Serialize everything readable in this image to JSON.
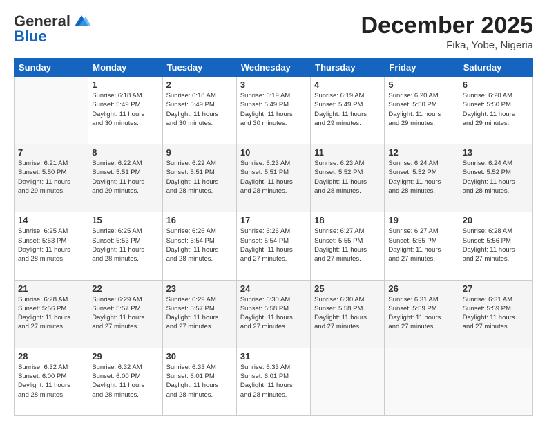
{
  "header": {
    "logo_general": "General",
    "logo_blue": "Blue",
    "main_title": "December 2025",
    "subtitle": "Fika, Yobe, Nigeria"
  },
  "columns": [
    "Sunday",
    "Monday",
    "Tuesday",
    "Wednesday",
    "Thursday",
    "Friday",
    "Saturday"
  ],
  "weeks": [
    [
      {
        "num": "",
        "info": ""
      },
      {
        "num": "1",
        "info": "Sunrise: 6:18 AM\nSunset: 5:49 PM\nDaylight: 11 hours\nand 30 minutes."
      },
      {
        "num": "2",
        "info": "Sunrise: 6:18 AM\nSunset: 5:49 PM\nDaylight: 11 hours\nand 30 minutes."
      },
      {
        "num": "3",
        "info": "Sunrise: 6:19 AM\nSunset: 5:49 PM\nDaylight: 11 hours\nand 30 minutes."
      },
      {
        "num": "4",
        "info": "Sunrise: 6:19 AM\nSunset: 5:49 PM\nDaylight: 11 hours\nand 29 minutes."
      },
      {
        "num": "5",
        "info": "Sunrise: 6:20 AM\nSunset: 5:50 PM\nDaylight: 11 hours\nand 29 minutes."
      },
      {
        "num": "6",
        "info": "Sunrise: 6:20 AM\nSunset: 5:50 PM\nDaylight: 11 hours\nand 29 minutes."
      }
    ],
    [
      {
        "num": "7",
        "info": "Sunrise: 6:21 AM\nSunset: 5:50 PM\nDaylight: 11 hours\nand 29 minutes."
      },
      {
        "num": "8",
        "info": "Sunrise: 6:22 AM\nSunset: 5:51 PM\nDaylight: 11 hours\nand 29 minutes."
      },
      {
        "num": "9",
        "info": "Sunrise: 6:22 AM\nSunset: 5:51 PM\nDaylight: 11 hours\nand 28 minutes."
      },
      {
        "num": "10",
        "info": "Sunrise: 6:23 AM\nSunset: 5:51 PM\nDaylight: 11 hours\nand 28 minutes."
      },
      {
        "num": "11",
        "info": "Sunrise: 6:23 AM\nSunset: 5:52 PM\nDaylight: 11 hours\nand 28 minutes."
      },
      {
        "num": "12",
        "info": "Sunrise: 6:24 AM\nSunset: 5:52 PM\nDaylight: 11 hours\nand 28 minutes."
      },
      {
        "num": "13",
        "info": "Sunrise: 6:24 AM\nSunset: 5:52 PM\nDaylight: 11 hours\nand 28 minutes."
      }
    ],
    [
      {
        "num": "14",
        "info": "Sunrise: 6:25 AM\nSunset: 5:53 PM\nDaylight: 11 hours\nand 28 minutes."
      },
      {
        "num": "15",
        "info": "Sunrise: 6:25 AM\nSunset: 5:53 PM\nDaylight: 11 hours\nand 28 minutes."
      },
      {
        "num": "16",
        "info": "Sunrise: 6:26 AM\nSunset: 5:54 PM\nDaylight: 11 hours\nand 28 minutes."
      },
      {
        "num": "17",
        "info": "Sunrise: 6:26 AM\nSunset: 5:54 PM\nDaylight: 11 hours\nand 27 minutes."
      },
      {
        "num": "18",
        "info": "Sunrise: 6:27 AM\nSunset: 5:55 PM\nDaylight: 11 hours\nand 27 minutes."
      },
      {
        "num": "19",
        "info": "Sunrise: 6:27 AM\nSunset: 5:55 PM\nDaylight: 11 hours\nand 27 minutes."
      },
      {
        "num": "20",
        "info": "Sunrise: 6:28 AM\nSunset: 5:56 PM\nDaylight: 11 hours\nand 27 minutes."
      }
    ],
    [
      {
        "num": "21",
        "info": "Sunrise: 6:28 AM\nSunset: 5:56 PM\nDaylight: 11 hours\nand 27 minutes."
      },
      {
        "num": "22",
        "info": "Sunrise: 6:29 AM\nSunset: 5:57 PM\nDaylight: 11 hours\nand 27 minutes."
      },
      {
        "num": "23",
        "info": "Sunrise: 6:29 AM\nSunset: 5:57 PM\nDaylight: 11 hours\nand 27 minutes."
      },
      {
        "num": "24",
        "info": "Sunrise: 6:30 AM\nSunset: 5:58 PM\nDaylight: 11 hours\nand 27 minutes."
      },
      {
        "num": "25",
        "info": "Sunrise: 6:30 AM\nSunset: 5:58 PM\nDaylight: 11 hours\nand 27 minutes."
      },
      {
        "num": "26",
        "info": "Sunrise: 6:31 AM\nSunset: 5:59 PM\nDaylight: 11 hours\nand 27 minutes."
      },
      {
        "num": "27",
        "info": "Sunrise: 6:31 AM\nSunset: 5:59 PM\nDaylight: 11 hours\nand 27 minutes."
      }
    ],
    [
      {
        "num": "28",
        "info": "Sunrise: 6:32 AM\nSunset: 6:00 PM\nDaylight: 11 hours\nand 28 minutes."
      },
      {
        "num": "29",
        "info": "Sunrise: 6:32 AM\nSunset: 6:00 PM\nDaylight: 11 hours\nand 28 minutes."
      },
      {
        "num": "30",
        "info": "Sunrise: 6:33 AM\nSunset: 6:01 PM\nDaylight: 11 hours\nand 28 minutes."
      },
      {
        "num": "31",
        "info": "Sunrise: 6:33 AM\nSunset: 6:01 PM\nDaylight: 11 hours\nand 28 minutes."
      },
      {
        "num": "",
        "info": ""
      },
      {
        "num": "",
        "info": ""
      },
      {
        "num": "",
        "info": ""
      }
    ]
  ]
}
